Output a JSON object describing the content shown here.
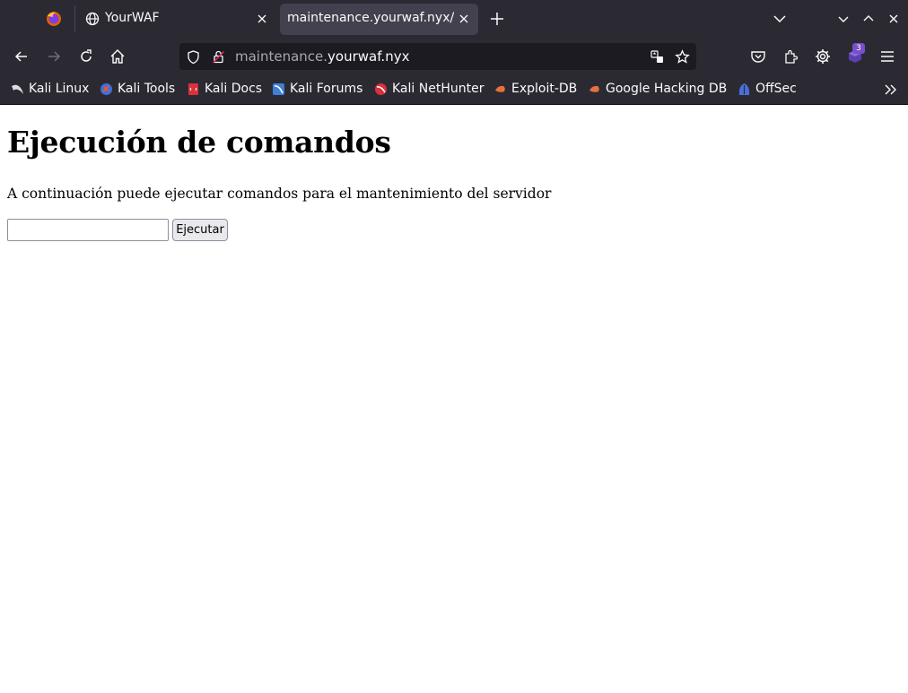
{
  "browser": {
    "tabs": [
      {
        "title": "YourWAF",
        "icon": "globe-icon",
        "active": false
      },
      {
        "title": "maintenance.yourwaf.nyx/",
        "icon": "none",
        "active": true
      }
    ],
    "url": {
      "prefix": "maintenance.",
      "host": "yourwaf.nyx"
    },
    "extension_badge": "3",
    "accent": "#2b2a33"
  },
  "bookmarks": [
    {
      "label": "Kali Linux",
      "icon": "kali-dragon-icon"
    },
    {
      "label": "Kali Tools",
      "icon": "kali-tools-icon"
    },
    {
      "label": "Kali Docs",
      "icon": "kali-docs-icon"
    },
    {
      "label": "Kali Forums",
      "icon": "kali-forums-icon"
    },
    {
      "label": "Kali NetHunter",
      "icon": "nethunter-icon"
    },
    {
      "label": "Exploit-DB",
      "icon": "exploit-db-icon"
    },
    {
      "label": "Google Hacking DB",
      "icon": "ghdb-icon"
    },
    {
      "label": "OffSec",
      "icon": "offsec-icon"
    }
  ],
  "page": {
    "heading": "Ejecución de comandos",
    "description": "A continuación puede ejecutar comandos para el mantenimiento del servidor",
    "command_value": "",
    "submit_label": "Ejecutar"
  }
}
